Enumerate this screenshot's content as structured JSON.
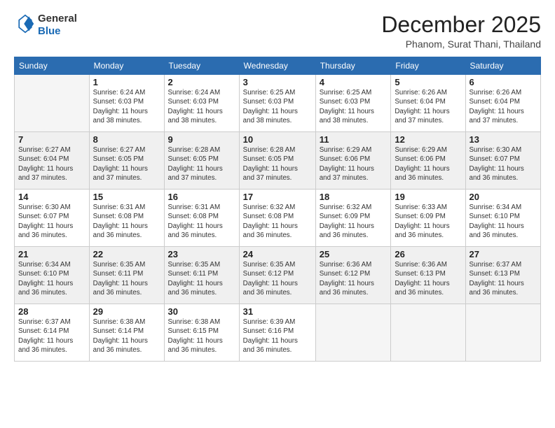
{
  "header": {
    "logo_line1": "General",
    "logo_line2": "Blue",
    "month_year": "December 2025",
    "location": "Phanom, Surat Thani, Thailand"
  },
  "days_of_week": [
    "Sunday",
    "Monday",
    "Tuesday",
    "Wednesday",
    "Thursday",
    "Friday",
    "Saturday"
  ],
  "weeks": [
    [
      {
        "day": "",
        "info": ""
      },
      {
        "day": "1",
        "info": "Sunrise: 6:24 AM\nSunset: 6:03 PM\nDaylight: 11 hours\nand 38 minutes."
      },
      {
        "day": "2",
        "info": "Sunrise: 6:24 AM\nSunset: 6:03 PM\nDaylight: 11 hours\nand 38 minutes."
      },
      {
        "day": "3",
        "info": "Sunrise: 6:25 AM\nSunset: 6:03 PM\nDaylight: 11 hours\nand 38 minutes."
      },
      {
        "day": "4",
        "info": "Sunrise: 6:25 AM\nSunset: 6:03 PM\nDaylight: 11 hours\nand 38 minutes."
      },
      {
        "day": "5",
        "info": "Sunrise: 6:26 AM\nSunset: 6:04 PM\nDaylight: 11 hours\nand 37 minutes."
      },
      {
        "day": "6",
        "info": "Sunrise: 6:26 AM\nSunset: 6:04 PM\nDaylight: 11 hours\nand 37 minutes."
      }
    ],
    [
      {
        "day": "7",
        "info": "Sunrise: 6:27 AM\nSunset: 6:04 PM\nDaylight: 11 hours\nand 37 minutes."
      },
      {
        "day": "8",
        "info": "Sunrise: 6:27 AM\nSunset: 6:05 PM\nDaylight: 11 hours\nand 37 minutes."
      },
      {
        "day": "9",
        "info": "Sunrise: 6:28 AM\nSunset: 6:05 PM\nDaylight: 11 hours\nand 37 minutes."
      },
      {
        "day": "10",
        "info": "Sunrise: 6:28 AM\nSunset: 6:05 PM\nDaylight: 11 hours\nand 37 minutes."
      },
      {
        "day": "11",
        "info": "Sunrise: 6:29 AM\nSunset: 6:06 PM\nDaylight: 11 hours\nand 37 minutes."
      },
      {
        "day": "12",
        "info": "Sunrise: 6:29 AM\nSunset: 6:06 PM\nDaylight: 11 hours\nand 36 minutes."
      },
      {
        "day": "13",
        "info": "Sunrise: 6:30 AM\nSunset: 6:07 PM\nDaylight: 11 hours\nand 36 minutes."
      }
    ],
    [
      {
        "day": "14",
        "info": "Sunrise: 6:30 AM\nSunset: 6:07 PM\nDaylight: 11 hours\nand 36 minutes."
      },
      {
        "day": "15",
        "info": "Sunrise: 6:31 AM\nSunset: 6:08 PM\nDaylight: 11 hours\nand 36 minutes."
      },
      {
        "day": "16",
        "info": "Sunrise: 6:31 AM\nSunset: 6:08 PM\nDaylight: 11 hours\nand 36 minutes."
      },
      {
        "day": "17",
        "info": "Sunrise: 6:32 AM\nSunset: 6:08 PM\nDaylight: 11 hours\nand 36 minutes."
      },
      {
        "day": "18",
        "info": "Sunrise: 6:32 AM\nSunset: 6:09 PM\nDaylight: 11 hours\nand 36 minutes."
      },
      {
        "day": "19",
        "info": "Sunrise: 6:33 AM\nSunset: 6:09 PM\nDaylight: 11 hours\nand 36 minutes."
      },
      {
        "day": "20",
        "info": "Sunrise: 6:34 AM\nSunset: 6:10 PM\nDaylight: 11 hours\nand 36 minutes."
      }
    ],
    [
      {
        "day": "21",
        "info": "Sunrise: 6:34 AM\nSunset: 6:10 PM\nDaylight: 11 hours\nand 36 minutes."
      },
      {
        "day": "22",
        "info": "Sunrise: 6:35 AM\nSunset: 6:11 PM\nDaylight: 11 hours\nand 36 minutes."
      },
      {
        "day": "23",
        "info": "Sunrise: 6:35 AM\nSunset: 6:11 PM\nDaylight: 11 hours\nand 36 minutes."
      },
      {
        "day": "24",
        "info": "Sunrise: 6:35 AM\nSunset: 6:12 PM\nDaylight: 11 hours\nand 36 minutes."
      },
      {
        "day": "25",
        "info": "Sunrise: 6:36 AM\nSunset: 6:12 PM\nDaylight: 11 hours\nand 36 minutes."
      },
      {
        "day": "26",
        "info": "Sunrise: 6:36 AM\nSunset: 6:13 PM\nDaylight: 11 hours\nand 36 minutes."
      },
      {
        "day": "27",
        "info": "Sunrise: 6:37 AM\nSunset: 6:13 PM\nDaylight: 11 hours\nand 36 minutes."
      }
    ],
    [
      {
        "day": "28",
        "info": "Sunrise: 6:37 AM\nSunset: 6:14 PM\nDaylight: 11 hours\nand 36 minutes."
      },
      {
        "day": "29",
        "info": "Sunrise: 6:38 AM\nSunset: 6:14 PM\nDaylight: 11 hours\nand 36 minutes."
      },
      {
        "day": "30",
        "info": "Sunrise: 6:38 AM\nSunset: 6:15 PM\nDaylight: 11 hours\nand 36 minutes."
      },
      {
        "day": "31",
        "info": "Sunrise: 6:39 AM\nSunset: 6:16 PM\nDaylight: 11 hours\nand 36 minutes."
      },
      {
        "day": "",
        "info": ""
      },
      {
        "day": "",
        "info": ""
      },
      {
        "day": "",
        "info": ""
      }
    ]
  ]
}
